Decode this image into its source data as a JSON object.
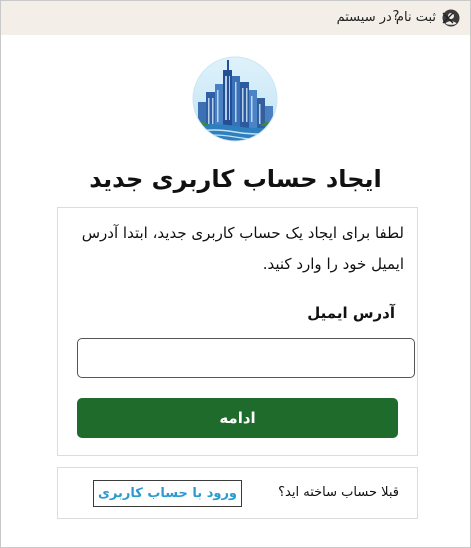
{
  "window": {
    "title": "ثبت نام در سیستم",
    "help_label": "?",
    "icon": "user-account-icon",
    "close_icon": "close-icon"
  },
  "logo": {
    "icon": "city-skyline-logo"
  },
  "heading": "ایجاد حساب کاربری جدید",
  "form": {
    "intro": "لطفا برای ایجاد یک حساب کاربری جدید، ابتدا آدرس ایمیل خود را وارد کنید.",
    "email_label": "آدرس ایمیل",
    "email_value": "",
    "continue_label": "ادامه"
  },
  "footer": {
    "question": "قبلا حساب ساخته اید؟",
    "login_link": "ورود با حساب کاربری"
  },
  "colors": {
    "primary_button": "#1e6b2c",
    "link": "#2a9bd1",
    "titlebar": "#f3efe8"
  }
}
